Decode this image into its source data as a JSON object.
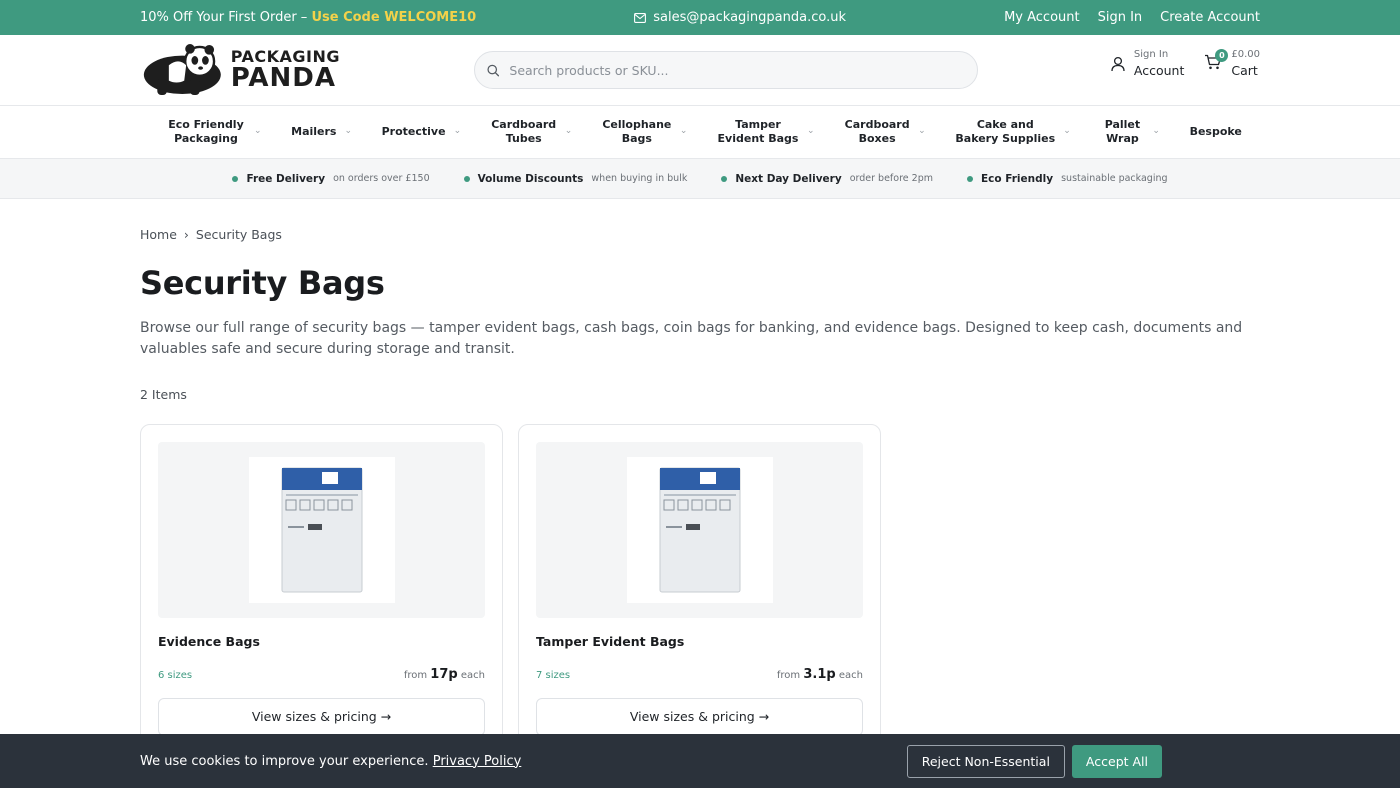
{
  "topbar": {
    "promo_text": "10% Off Your First Order – ",
    "promo_code": "Use Code WELCOME10",
    "email": "sales@packagingpanda.co.uk",
    "links": [
      "My Account",
      "Sign In",
      "Create Account"
    ]
  },
  "header": {
    "logo_line1": "PACKAGING",
    "logo_line2": "PANDA",
    "search_placeholder": "Search products or SKU...",
    "account_small": "Sign In",
    "account_big": "Account",
    "cart_count": "0",
    "cart_total": "£0.00",
    "cart_label": "Cart"
  },
  "nav": [
    {
      "label": "Eco Friendly Packaging",
      "dropdown": true
    },
    {
      "label": "Mailers",
      "dropdown": true
    },
    {
      "label": "Protective",
      "dropdown": true
    },
    {
      "label": "Cardboard Tubes",
      "dropdown": true
    },
    {
      "label": "Cellophane Bags",
      "dropdown": true
    },
    {
      "label": "Tamper Evident Bags",
      "dropdown": true
    },
    {
      "label": "Cardboard Boxes",
      "dropdown": true
    },
    {
      "label": "Cake and Bakery Supplies",
      "dropdown": true
    },
    {
      "label": "Pallet Wrap",
      "dropdown": true
    },
    {
      "label": "Bespoke",
      "dropdown": false
    }
  ],
  "usps": [
    {
      "title": "Free Delivery",
      "sub": "on orders over £150"
    },
    {
      "title": "Volume Discounts",
      "sub": "when buying in bulk"
    },
    {
      "title": "Next Day Delivery",
      "sub": "order before 2pm"
    },
    {
      "title": "Eco Friendly",
      "sub": "sustainable packaging"
    }
  ],
  "breadcrumb": {
    "home": "Home",
    "sep": "›",
    "current": "Security Bags"
  },
  "page": {
    "title": "Security Bags",
    "description": "Browse our full range of security bags — tamper evident bags, cash bags, coin bags for banking, and evidence bags. Designed to keep cash, documents and valuables safe and secure during storage and transit.",
    "item_count": "2 Items"
  },
  "products": [
    {
      "name": "Evidence Bags",
      "sizes": "6 sizes",
      "from": "from",
      "price": "17p",
      "unit": "each",
      "button": "View sizes & pricing →"
    },
    {
      "name": "Tamper Evident Bags",
      "sizes": "7 sizes",
      "from": "from",
      "price": "3.1p",
      "unit": "each",
      "button": "View sizes & pricing →"
    }
  ],
  "cookie": {
    "text": "We use cookies to improve your experience. ",
    "policy": "Privacy Policy",
    "reject": "Reject Non-Essential",
    "accept": "Accept All"
  },
  "colors": {
    "brand": "#3f9a80",
    "promo": "#f3d24a",
    "cookie_bg": "#2b323b"
  }
}
